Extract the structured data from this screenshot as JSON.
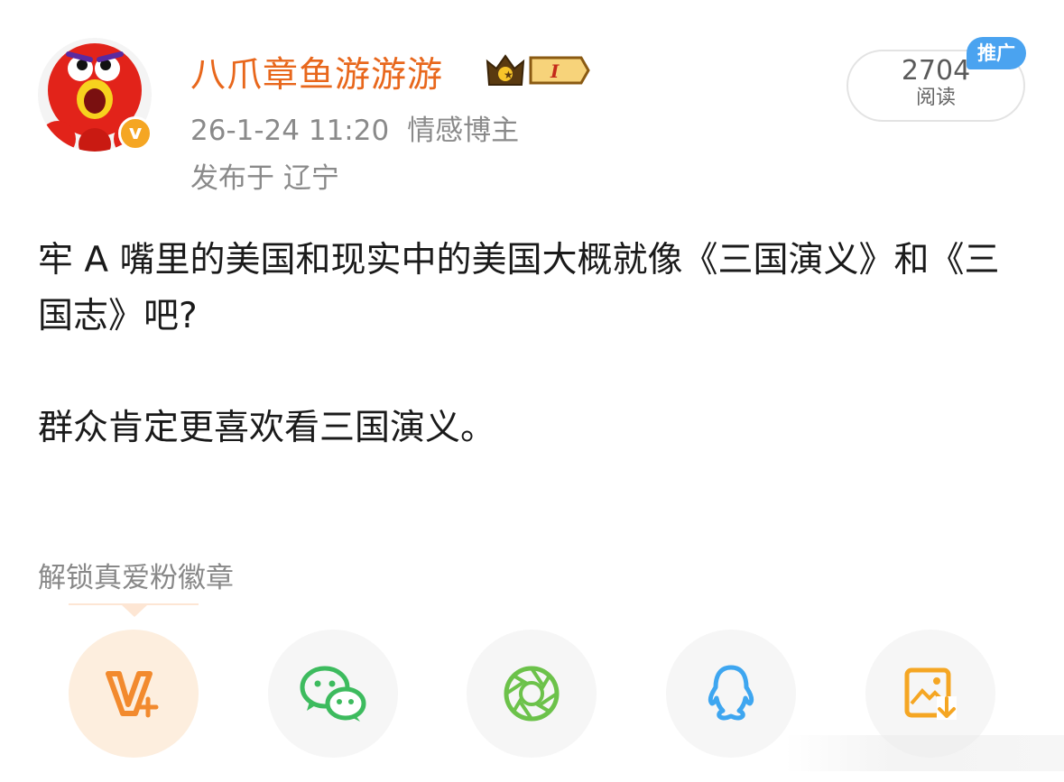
{
  "post": {
    "author": "八爪章鱼游游游",
    "verified_mark": "v",
    "level_badge": "I",
    "timestamp": "26-1-24 11:20",
    "category": "情感博主",
    "location": "发布于 辽宁",
    "read_count": "2704",
    "read_label": "阅读",
    "promo_tag": "推广",
    "content_lines": [
      "牢 A 嘴里的美国和现实中的美国大概就像《三国演义》和《三国志》吧?",
      "群众肯定更喜欢看三国演义。"
    ],
    "fan_badge_text": "解锁真爱粉徽章"
  },
  "share_bar": {
    "items": [
      {
        "icon": "weibo-vplus-icon",
        "active": true,
        "color": "#f28a2e"
      },
      {
        "icon": "wechat-icon",
        "color": "#3dbb5e"
      },
      {
        "icon": "moments-icon",
        "color": "#6cc24a"
      },
      {
        "icon": "qq-icon",
        "color": "#3ea6f0"
      },
      {
        "icon": "save-image-icon",
        "color": "#f5a623"
      }
    ]
  },
  "colors": {
    "author_name": "#e8671c",
    "meta_text": "#8a8a8a",
    "promo_bg": "#4aa3f0"
  }
}
